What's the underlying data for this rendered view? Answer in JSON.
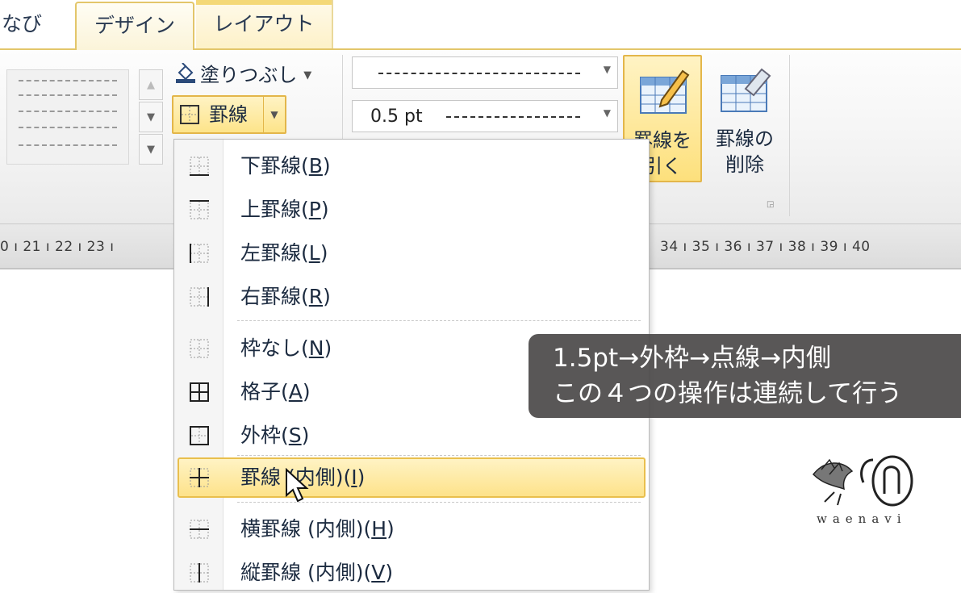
{
  "tabs": [
    {
      "label": "なび",
      "state": "partial"
    },
    {
      "label": "デザイン",
      "state": "active"
    },
    {
      "label": "レイアウト",
      "state": "contextual"
    }
  ],
  "ribbon": {
    "shading_button": "塗りつぶし",
    "borders_button": "罫線",
    "pen_weight": "0.5 pt",
    "draw_table_label": [
      "罫線を",
      "引く"
    ],
    "eraser_label": [
      "罫線の",
      "削除"
    ]
  },
  "ruler": {
    "left_text": "0 ı 21 ı 22 ı 23 ı",
    "right_text": "34 ı 35 ı 36 ı 37 ı 38 ı 39 ı 40"
  },
  "menu": {
    "items": [
      {
        "label": "下罫線(",
        "key": "B",
        "suffix": ")",
        "icon": "bottom-border-icon"
      },
      {
        "label": "上罫線(",
        "key": "P",
        "suffix": ")",
        "icon": "top-border-icon"
      },
      {
        "label": "左罫線(",
        "key": "L",
        "suffix": ")",
        "icon": "left-border-icon"
      },
      {
        "label": "右罫線(",
        "key": "R",
        "suffix": ")",
        "icon": "right-border-icon"
      },
      {
        "label": "枠なし(",
        "key": "N",
        "suffix": ")",
        "icon": "no-border-icon"
      },
      {
        "label": "格子(",
        "key": "A",
        "suffix": ")",
        "icon": "all-borders-icon"
      },
      {
        "label": "外枠(",
        "key": "S",
        "suffix": ")",
        "icon": "outside-borders-icon"
      },
      {
        "label": "罫線 (内側)(",
        "key": "I",
        "suffix": ")",
        "icon": "inside-borders-icon",
        "highlighted": true
      },
      {
        "label": "横罫線 (内側)(",
        "key": "H",
        "suffix": ")",
        "icon": "inside-horizontal-border-icon"
      },
      {
        "label": "縦罫線 (内側)(",
        "key": "V",
        "suffix": ")",
        "icon": "inside-vertical-border-icon"
      }
    ]
  },
  "annotation": {
    "line1": "1.5pt→外枠→点線→内側",
    "line2": "この４つの操作は連続して行う"
  },
  "logo": {
    "text": "waenavi"
  },
  "colors": {
    "accent_yellow": "#fde28a",
    "accent_border": "#e3b64a",
    "caption_bg": "#4b4949"
  }
}
